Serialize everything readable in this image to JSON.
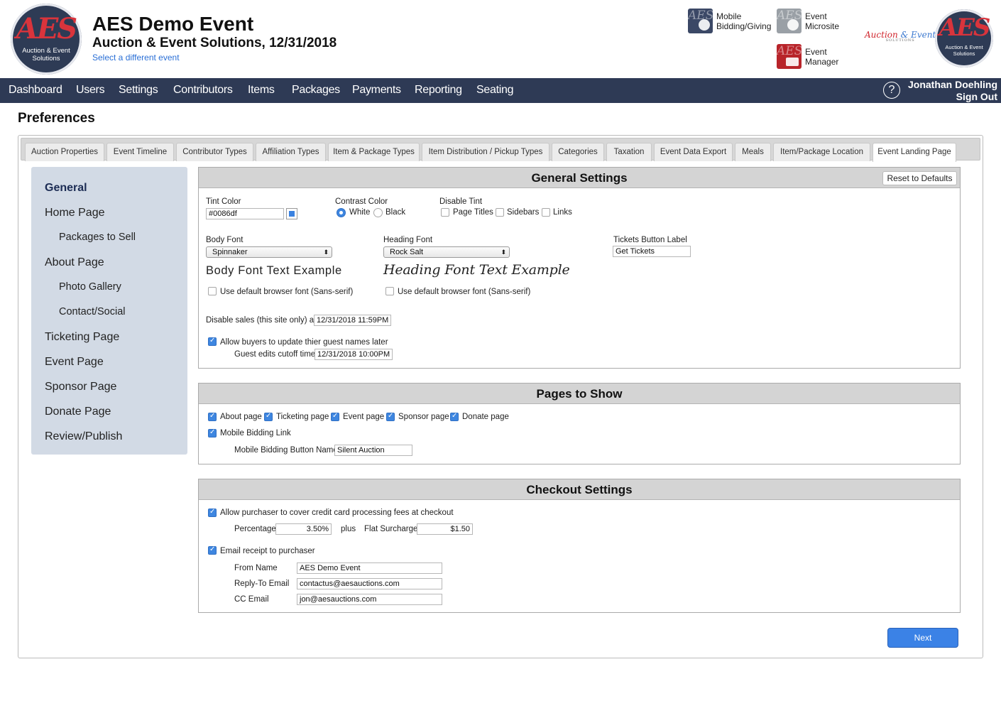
{
  "header": {
    "logo_caption": "Auction & Event Solutions",
    "logo_mono": "AES",
    "event_title": "AES Demo Event",
    "event_subtitle": "Auction & Event Solutions, 12/31/2018",
    "change_event_link": "Select a different event",
    "apps": [
      {
        "label": "Mobile Bidding/Giving",
        "icon": "mobile-bidding-icon"
      },
      {
        "label": "Event Microsite",
        "icon": "microsite-icon"
      },
      {
        "label": "Event Manager",
        "icon": "event-manager-icon"
      }
    ],
    "brand_text_a": "Auction",
    "brand_text_b": "& Event",
    "brand_text_small": "SOLUTIONS"
  },
  "nav": {
    "items": [
      "Dashboard",
      "Users",
      "Settings",
      "Contributors",
      "Items",
      "Packages",
      "Payments",
      "Reporting",
      "Seating"
    ],
    "help_glyph": "?",
    "user_name": "Jonathan Doehling",
    "sign_out": "Sign Out"
  },
  "page": {
    "title": "Preferences",
    "tabs": [
      "Auction Properties",
      "Event Timeline",
      "Contributor Types",
      "Affiliation Types",
      "Item & Package Types",
      "Item Distribution / Pickup Types",
      "Categories",
      "Taxation",
      "Event Data Export",
      "Meals",
      "Item/Package Location",
      "Event Landing Page"
    ],
    "active_tab": "Event Landing Page"
  },
  "sidebar": {
    "items": [
      "General",
      "Home Page",
      "Packages to Sell",
      "About Page",
      "Photo Gallery",
      "Contact/Social",
      "Ticketing Page",
      "Event Page",
      "Sponsor Page",
      "Donate Page",
      "Review/Publish"
    ],
    "current": "General"
  },
  "general": {
    "title": "General Settings",
    "reset_label": "Reset to Defaults",
    "tint_label": "Tint Color",
    "tint_value": "#0086df",
    "tint_swatch_color": "#3a82e0",
    "contrast_label": "Contrast Color",
    "contrast_white": "White",
    "contrast_black": "Black",
    "contrast_selected": "White",
    "disable_tint_label": "Disable Tint",
    "disable_page_titles": "Page Titles",
    "disable_sidebars": "Sidebars",
    "disable_links": "Links",
    "body_font_label": "Body Font",
    "body_font_value": "Spinnaker",
    "heading_font_label": "Heading Font",
    "heading_font_value": "Rock Salt",
    "tickets_label": "Tickets Button Label",
    "tickets_value": "Get Tickets",
    "body_example": "Body Font Text Example",
    "heading_example": "Heading Font Text Example",
    "default_font_body": "Use default browser font (Sans-serif)",
    "default_font_heading": "Use default browser font (Sans-serif)",
    "disable_sales_label": "Disable sales (this site only) at",
    "disable_sales_value": "12/31/2018 11:59PM",
    "allow_update_label": "Allow buyers to update thier guest names later",
    "allow_update_checked": true,
    "cutoff_label": "Guest edits cutoff time",
    "cutoff_value": "12/31/2018 10:00PM"
  },
  "pages_to_show": {
    "title": "Pages to Show",
    "about": "About page",
    "ticketing": "Ticketing page",
    "event": "Event page",
    "sponsor": "Sponsor page",
    "donate": "Donate page",
    "mobile_link": "Mobile Bidding Link",
    "mobile_button_label": "Mobile Bidding Button Name",
    "mobile_button_value": "Silent Auction"
  },
  "checkout": {
    "title": "Checkout Settings",
    "cover_fees_label": "Allow purchaser to cover credit card processing fees at checkout",
    "percentage_label": "Percentage",
    "percentage_value": "3.50%",
    "plus_label": "plus",
    "surcharge_label": "Flat Surcharge",
    "surcharge_value": "$1.50",
    "email_receipt_label": "Email receipt to purchaser",
    "from_name_label": "From Name",
    "from_name_value": "AES Demo Event",
    "reply_label": "Reply-To Email",
    "reply_value": "contactus@aesauctions.com",
    "cc_label": "CC Email",
    "cc_value": "jon@aesauctions.com"
  },
  "footer": {
    "next_label": "Next"
  },
  "colors": {
    "nav_bg": "#2e3a55",
    "accent": "#3b82e6",
    "sidebar_bg": "#d2dae5"
  }
}
